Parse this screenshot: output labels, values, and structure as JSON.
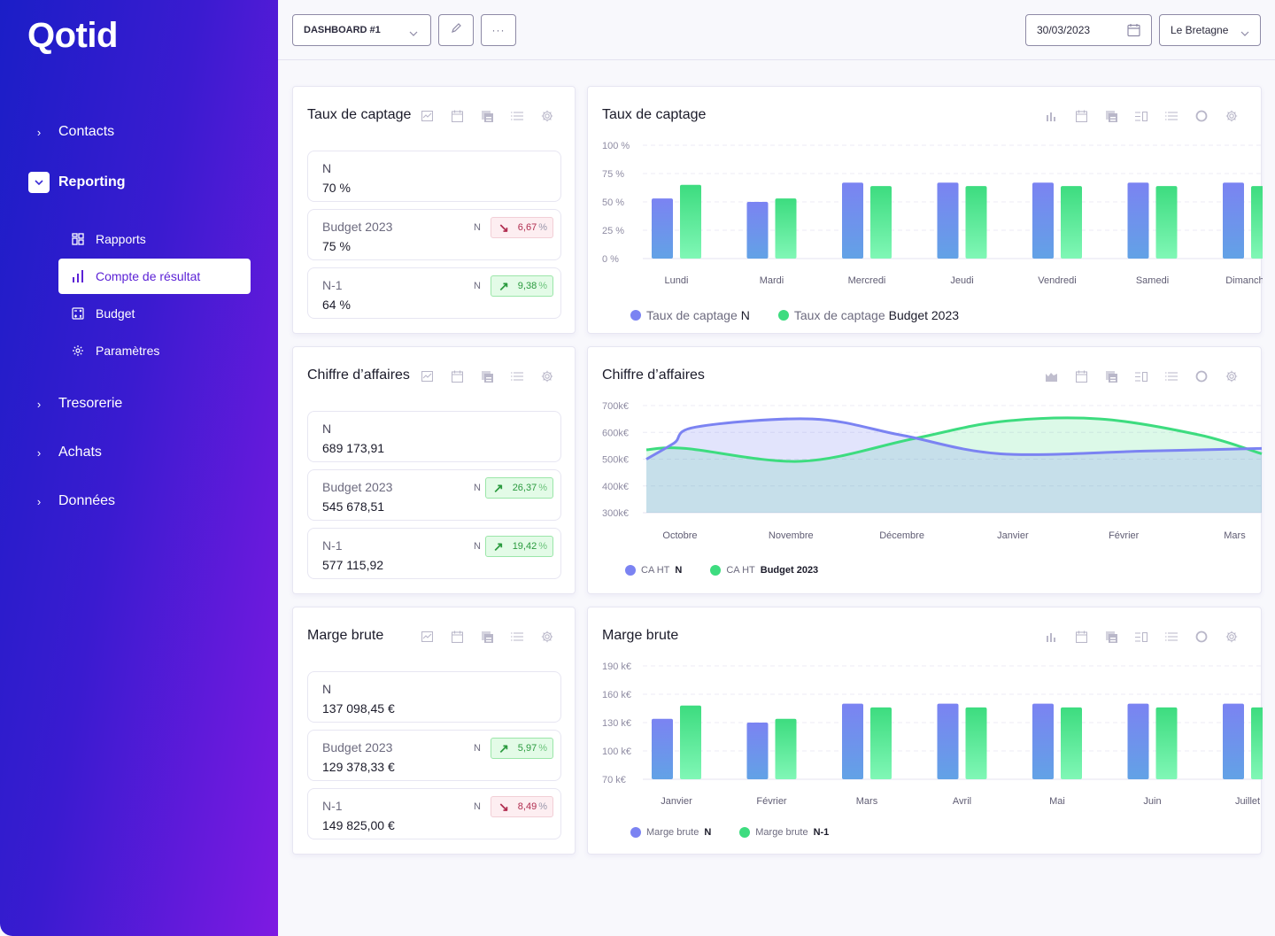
{
  "app": {
    "logo": "Qotid"
  },
  "sidebar": {
    "items": [
      {
        "label": "Contacts",
        "expanded": false
      },
      {
        "label": "Reporting",
        "expanded": true
      },
      {
        "label": "Tresorerie",
        "expanded": false
      },
      {
        "label": "Achats",
        "expanded": false
      },
      {
        "label": "Données",
        "expanded": false
      }
    ],
    "sub_items": [
      {
        "label": "Rapports",
        "icon": "grid-icon",
        "active": false
      },
      {
        "label": "Compte de résultat",
        "icon": "bar-chart-icon",
        "active": true
      },
      {
        "label": "Budget",
        "icon": "calculator-icon",
        "active": false
      },
      {
        "label": "Paramètres",
        "icon": "gear-icon",
        "active": false
      }
    ]
  },
  "toolbar": {
    "dashboard_select": "DASHBOARD #1",
    "edit_icon": "pencil-icon",
    "more_label": "···",
    "date_value": "30/03/2023",
    "site_select": "Le Bretagne"
  },
  "kpis": [
    {
      "title": "Taux de captage",
      "rows": [
        {
          "label": "N",
          "value": "70 %"
        },
        {
          "label": "Budget 2023",
          "value": "75 %",
          "compare": "N",
          "trend": "down",
          "delta": "6,67",
          "unit": "%"
        },
        {
          "label": "N-1",
          "value": "64 %",
          "compare": "N",
          "trend": "up",
          "delta": "9,38",
          "unit": "%"
        }
      ]
    },
    {
      "title": "Chiffre d’affaires",
      "rows": [
        {
          "label": "N",
          "value": "689 173,91"
        },
        {
          "label": "Budget 2023",
          "value": "545 678,51",
          "compare": "N",
          "trend": "up",
          "delta": "26,37",
          "unit": "%"
        },
        {
          "label": "N-1",
          "value": "577 115,92",
          "compare": "N",
          "trend": "up",
          "delta": "19,42",
          "unit": "%"
        }
      ]
    },
    {
      "title": "Marge brute",
      "rows": [
        {
          "label": "N",
          "value": "137 098,45 €"
        },
        {
          "label": "Budget 2023",
          "value": "129 378,33 €",
          "compare": "N",
          "trend": "up",
          "delta": "5,97",
          "unit": "%"
        },
        {
          "label": "N-1",
          "value": "149 825,00 €",
          "compare": "N",
          "trend": "down",
          "delta": "8,49",
          "unit": "%"
        }
      ]
    }
  ],
  "colors": {
    "series_n": "#7b83f2",
    "series_n_bottom": "#62a2e6",
    "series_cmp": "#3ddc7f",
    "series_cmp_bottom": "#80f7b6",
    "accent": "#5c22d6"
  },
  "chart_data": [
    {
      "type": "bar",
      "title": "Taux de captage",
      "categories": [
        "Lundi",
        "Mardi",
        "Mercredi",
        "Jeudi",
        "Vendredi",
        "Samedi",
        "Dimanche"
      ],
      "series": [
        {
          "name": "Taux de captage",
          "name_strong": "N",
          "values": [
            53,
            50,
            67,
            67,
            67,
            67,
            67
          ]
        },
        {
          "name": "Taux de captage",
          "name_strong": "Budget 2023",
          "values": [
            65,
            53,
            64,
            64,
            64,
            64,
            64
          ]
        }
      ],
      "yticks": [
        "0 %",
        "25 %",
        "50 %",
        "75 %",
        "100 %"
      ],
      "ylim": [
        0,
        100
      ],
      "grid": true,
      "legend": "bottom-left"
    },
    {
      "type": "area",
      "title": "Chiffre d’affaires",
      "categories": [
        "Octobre",
        "Novembre",
        "Décembre",
        "Janvier",
        "Février",
        "Mars"
      ],
      "series": [
        {
          "name": "CA HT",
          "name_strong": "N",
          "x": [
            0,
            0.25,
            0.45,
            1.5,
            2.3,
            3.2,
            4.5,
            5.6
          ],
          "values": [
            500,
            560,
            620,
            650,
            590,
            520,
            530,
            540
          ]
        },
        {
          "name": "CA HT",
          "name_strong": "Budget 2023",
          "x": [
            0,
            0.35,
            1.4,
            2.4,
            3.2,
            4.1,
            5.0,
            5.6
          ],
          "values": [
            535,
            540,
            492,
            575,
            640,
            650,
            590,
            520
          ]
        }
      ],
      "yticks": [
        "300k€",
        "400k€",
        "500k€",
        "600k€",
        "700k€"
      ],
      "ylim": [
        300,
        700
      ],
      "grid": true,
      "legend": "bottom-left"
    },
    {
      "type": "bar",
      "title": "Marge brute",
      "categories": [
        "Janvier",
        "Février",
        "Mars",
        "Avril",
        "Mai",
        "Juin",
        "Juillet"
      ],
      "series": [
        {
          "name": "Marge brute",
          "name_strong": "N",
          "values": [
            134,
            130,
            150,
            150,
            150,
            150,
            150
          ]
        },
        {
          "name": "Marge brute",
          "name_strong": "N-1",
          "values": [
            148,
            134,
            146,
            146,
            146,
            146,
            146
          ]
        }
      ],
      "yticks": [
        "70 k€",
        "100 k€",
        "130 k€",
        "160 k€",
        "190 k€"
      ],
      "ylim": [
        70,
        190
      ],
      "grid": true,
      "legend": "bottom-left"
    }
  ]
}
